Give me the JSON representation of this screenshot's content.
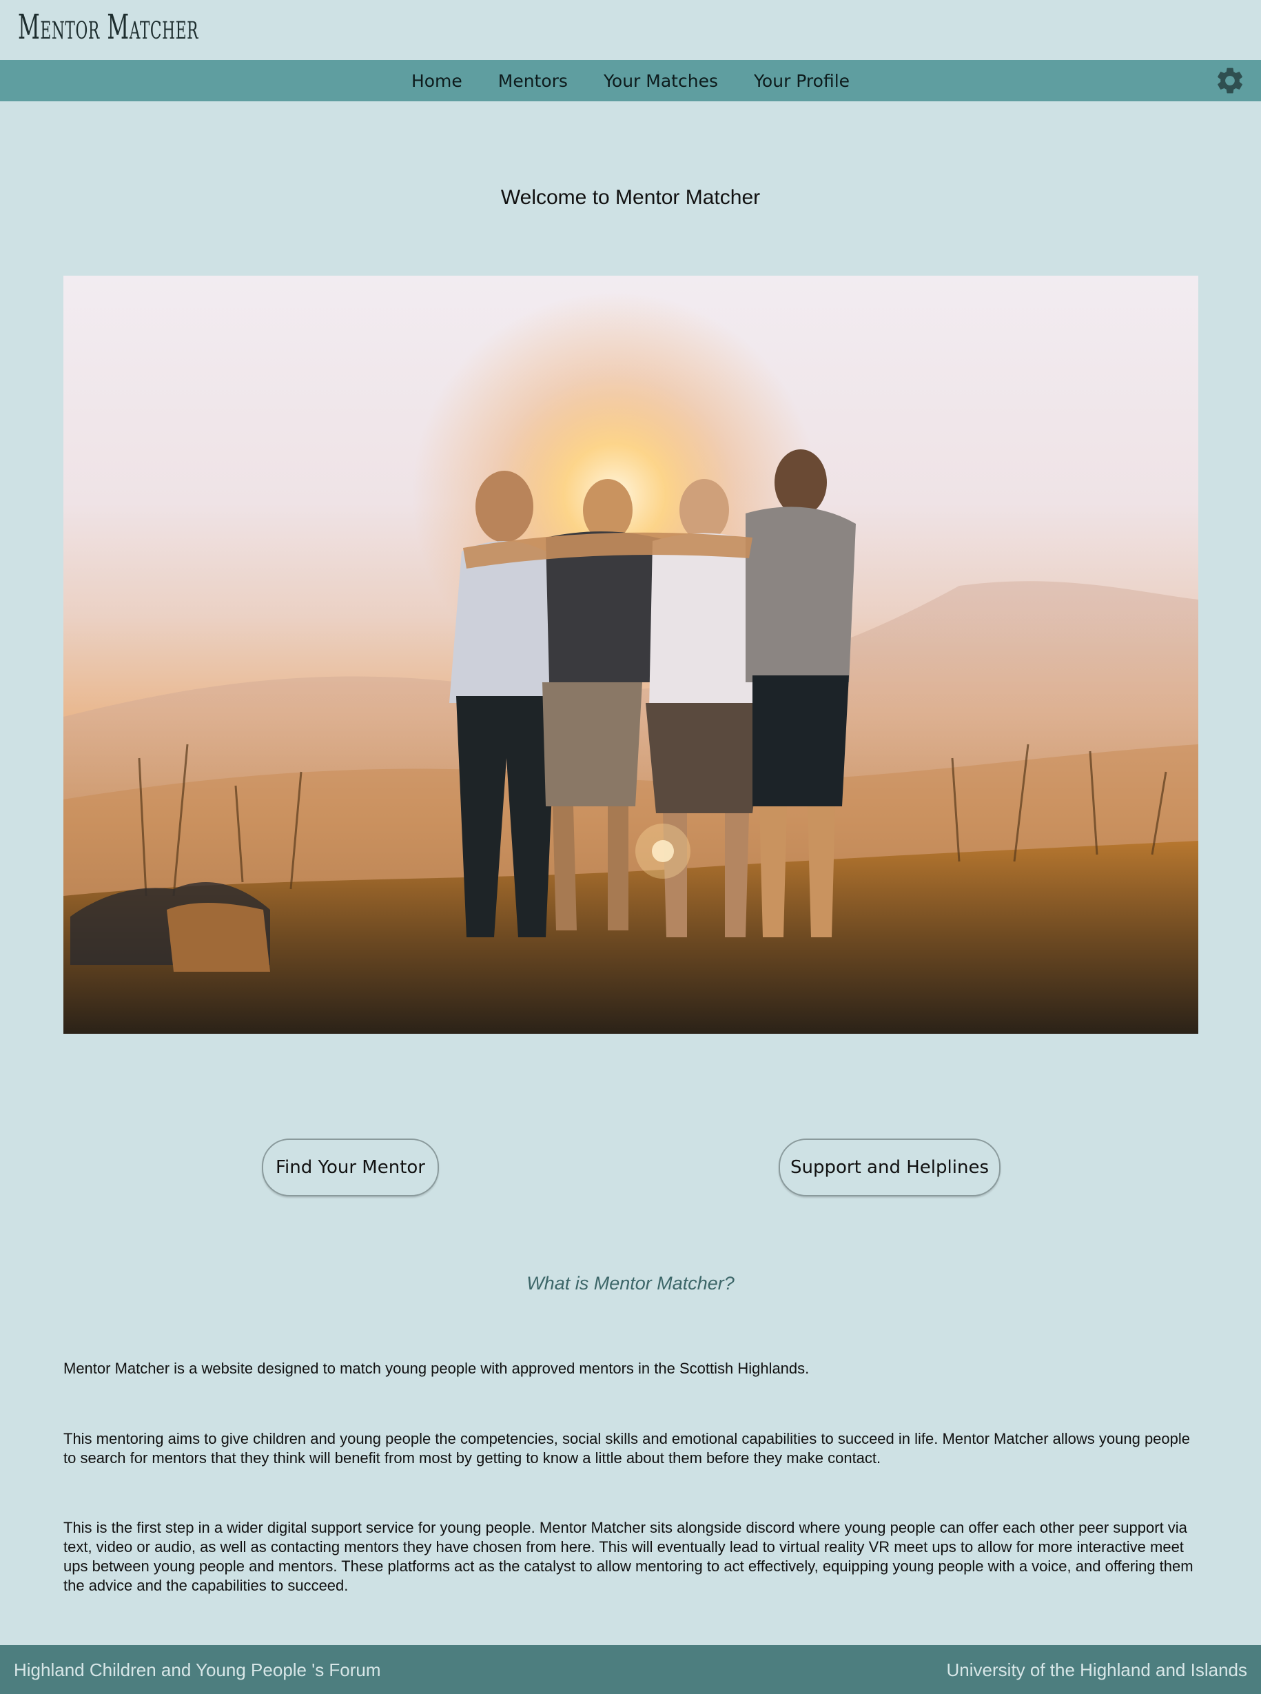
{
  "header": {
    "brand": "Mentor Matcher"
  },
  "nav": {
    "items": [
      {
        "label": "Home"
      },
      {
        "label": "Mentors"
      },
      {
        "label": "Your Matches"
      },
      {
        "label": "Your Profile"
      }
    ],
    "settings_icon": "gear-icon"
  },
  "main": {
    "welcome": "Welcome to Mentor Matcher",
    "hero_image_alt": "Four friends embracing on a hilltop at sunset",
    "buttons": {
      "find_mentor": "Find Your Mentor",
      "support": "Support and Helplines"
    },
    "about": {
      "title": "What is Mentor Matcher?",
      "paragraphs": [
        "Mentor Matcher is a website designed to match young people with approved mentors in the Scottish Highlands.",
        "This mentoring aims to give children and young people the competencies, social skills and emotional capabilities to succeed in life. Mentor Matcher allows young people to search for mentors that they think will benefit from most by getting to know a little about them before they make contact.",
        "This is the first step in a wider digital support service for young people. Mentor Matcher sits alongside discord where young people can offer each other peer support via text, video or audio, as well as contacting mentors they have chosen from here. This will eventually lead to virtual reality VR meet ups to allow for more interactive meet ups between young people and mentors. These platforms act as the catalyst to allow mentoring to act effectively, equipping young people with a voice, and offering them the advice and the capabilities to succeed."
      ]
    }
  },
  "footer": {
    "left": "Highland Children and Young People 's Forum",
    "right": "University of the Highland and Islands"
  },
  "colors": {
    "page_bg": "#cee1e4",
    "nav_bg": "#5f9ea0",
    "footer_bg": "#4d7e7f",
    "subtitle": "#3c6668"
  }
}
